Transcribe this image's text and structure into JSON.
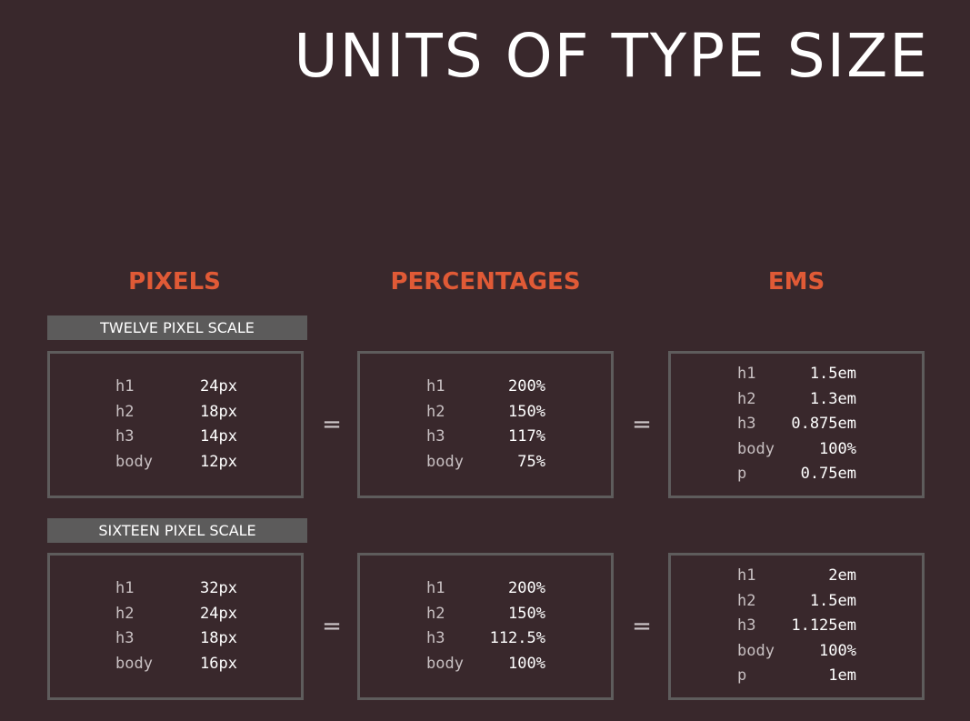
{
  "title": "UNITS OF TYPE SIZE",
  "columns": {
    "pixels": "PIXELS",
    "percentages": "PERCENTAGES",
    "ems": "EMS"
  },
  "colors": {
    "background": "#39282c",
    "heading_accent": "#e05a36",
    "scale_bar": "#5c5b5b",
    "box_border": "#5e5c5c"
  },
  "equals_sign": "=",
  "twelve": {
    "label": "TWELVE PIXEL SCALE",
    "pixels": [
      {
        "k": "h1",
        "v": "24px"
      },
      {
        "k": "h2",
        "v": "18px"
      },
      {
        "k": "h3",
        "v": "14px"
      },
      {
        "k": "body",
        "v": "12px"
      }
    ],
    "percentages": [
      {
        "k": "h1",
        "v": "200%"
      },
      {
        "k": "h2",
        "v": "150%"
      },
      {
        "k": "h3",
        "v": "117%"
      },
      {
        "k": "body",
        "v": "75%"
      }
    ],
    "ems": [
      {
        "k": "h1",
        "v": "1.5em"
      },
      {
        "k": "h2",
        "v": "1.3em"
      },
      {
        "k": "h3",
        "v": "0.875em"
      },
      {
        "k": "body",
        "v": "100%"
      },
      {
        "k": "p",
        "v": "0.75em"
      }
    ]
  },
  "sixteen": {
    "label": "SIXTEEN PIXEL SCALE",
    "pixels": [
      {
        "k": "h1",
        "v": "32px"
      },
      {
        "k": "h2",
        "v": "24px"
      },
      {
        "k": "h3",
        "v": "18px"
      },
      {
        "k": "body",
        "v": "16px"
      }
    ],
    "percentages": [
      {
        "k": "h1",
        "v": "200%"
      },
      {
        "k": "h2",
        "v": "150%"
      },
      {
        "k": "h3",
        "v": "112.5%"
      },
      {
        "k": "body",
        "v": "100%"
      }
    ],
    "ems": [
      {
        "k": "h1",
        "v": "2em"
      },
      {
        "k": "h2",
        "v": "1.5em"
      },
      {
        "k": "h3",
        "v": "1.125em"
      },
      {
        "k": "body",
        "v": "100%"
      },
      {
        "k": "p",
        "v": "1em"
      }
    ]
  }
}
